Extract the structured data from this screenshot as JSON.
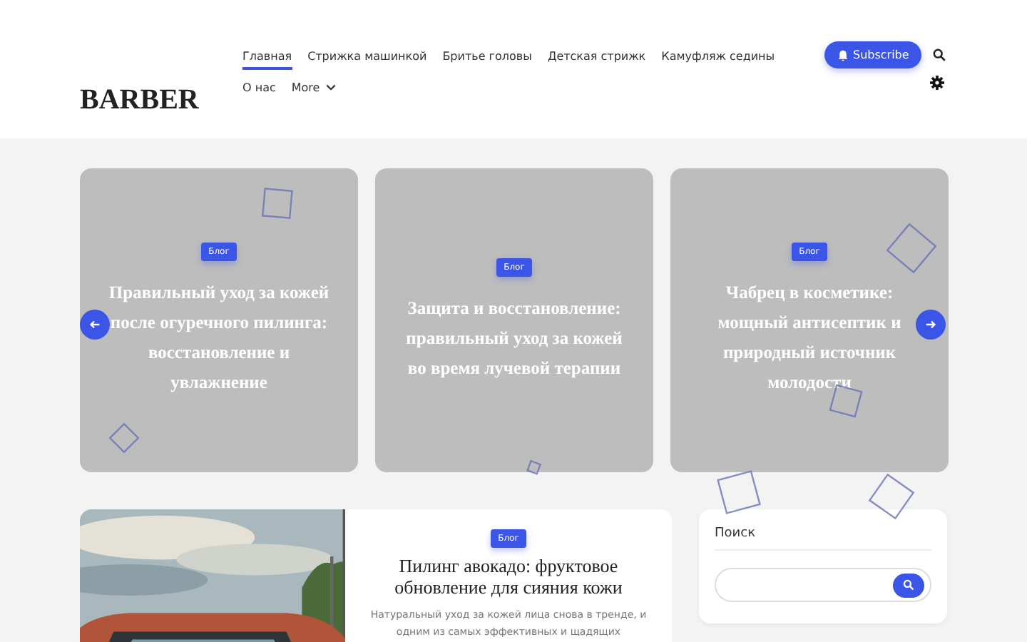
{
  "site": {
    "logo": "BARBER"
  },
  "nav": [
    {
      "label": "Главная",
      "selected": true
    },
    {
      "label": "Стрижка машинкой",
      "selected": false
    },
    {
      "label": "Бритье головы",
      "selected": false
    },
    {
      "label": "Детская стрижк",
      "selected": false
    },
    {
      "label": "Камуфляж седины",
      "selected": false
    },
    {
      "label": "О нас",
      "selected": false
    },
    {
      "label": "More",
      "selected": false,
      "kind": "dropdown"
    }
  ],
  "subscribe": {
    "label": "Subscribe"
  },
  "slider": [
    {
      "tag": "Блог",
      "title": "Правильный уход за кожей после огуречного пилинга: восстановление и увлажнение"
    },
    {
      "tag": "Блог",
      "title": "Защита и восстановление: правильный уход за кожей во время лучевой терапии"
    },
    {
      "tag": "Блог",
      "title": "Чабрец в косметике: мощный антисептик и природный источник молодости"
    }
  ],
  "post": {
    "kind": "picture",
    "tag": "Блог",
    "title": "Пилинг авокадо: фруктовое обновление для сияния кожи",
    "excerpt": "Натуральный уход за кожей лица снова в тренде, и одним из самых эффективных и щадящих"
  },
  "sidebar": {
    "title": "Поиск"
  }
}
